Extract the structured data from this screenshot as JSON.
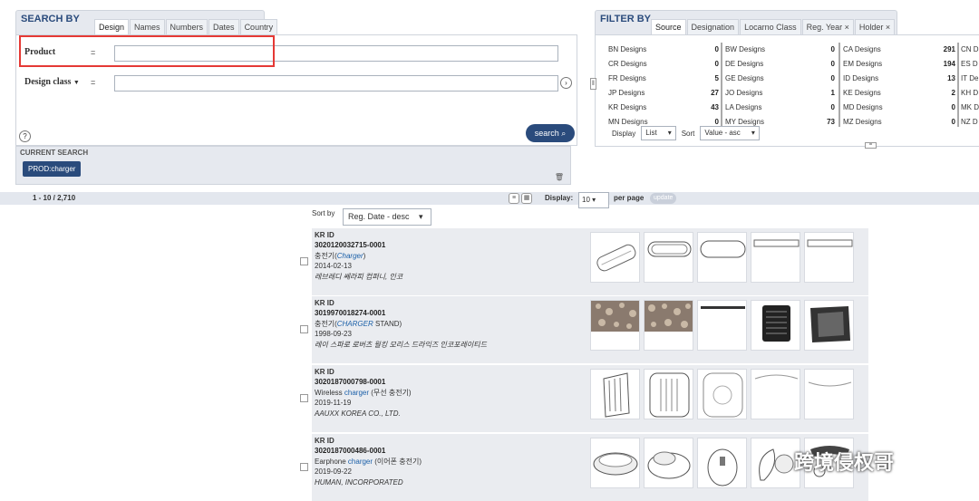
{
  "search": {
    "title": "SEARCH BY",
    "tabs": [
      "Design",
      "Names",
      "Numbers",
      "Dates",
      "Country"
    ],
    "product_label": "Product",
    "eq": "=",
    "design_class_label": "Design class",
    "design_class_arrow": "▼",
    "product_value": "",
    "design_class_value": "",
    "help": "?",
    "arrow": "›",
    "button": "search"
  },
  "current_search": {
    "title": "CURRENT SEARCH",
    "chip": "PROD:charger"
  },
  "filter": {
    "title": "FILTER BY",
    "tabs": [
      "Source",
      "Designation",
      "Locarno Class",
      "Reg. Year ×",
      "Holder ×"
    ],
    "columns": [
      [
        {
          "name": "BN Designs",
          "count": "0"
        },
        {
          "name": "CR Designs",
          "count": "0"
        },
        {
          "name": "FR Designs",
          "count": "5"
        },
        {
          "name": "JP Designs",
          "count": "27"
        },
        {
          "name": "KR Designs",
          "count": "43"
        },
        {
          "name": "MN Designs",
          "count": "0"
        }
      ],
      [
        {
          "name": "BW Designs",
          "count": "0"
        },
        {
          "name": "DE Designs",
          "count": "0"
        },
        {
          "name": "GE Designs",
          "count": "0"
        },
        {
          "name": "JO Designs",
          "count": "1"
        },
        {
          "name": "LA Designs",
          "count": "0"
        },
        {
          "name": "MY Designs",
          "count": "73"
        }
      ],
      [
        {
          "name": "CA Designs",
          "count": "291"
        },
        {
          "name": "EM Designs",
          "count": "194"
        },
        {
          "name": "ID Designs",
          "count": "13"
        },
        {
          "name": "KE Designs",
          "count": "2"
        },
        {
          "name": "MD Designs",
          "count": "0"
        },
        {
          "name": "MZ Designs",
          "count": "0"
        }
      ],
      [
        {
          "name": "CN D",
          "count": ""
        },
        {
          "name": "ES D",
          "count": ""
        },
        {
          "name": "IT De",
          "count": ""
        },
        {
          "name": "KH D",
          "count": ""
        },
        {
          "name": "MK D",
          "count": ""
        },
        {
          "name": "NZ D",
          "count": ""
        }
      ]
    ],
    "display_label": "Display",
    "display_value": "List",
    "sort_label": "Sort",
    "sort_value": "Value - asc"
  },
  "results": {
    "count": "1 - 10 / 2,710",
    "display_label": "Display:",
    "per_page_value": "10",
    "per_page_label": "per page",
    "update": "update",
    "sort_label": "Sort by",
    "sort_value": "Reg. Date - desc",
    "items": [
      {
        "source": "KR ID",
        "number": "3020120032715-0001",
        "title_pre": "충전기(",
        "title_hl": "Charger",
        "title_post": ")",
        "date": "2014-02-13",
        "owner": "레브레디 쎄라피 컴퍼니, 인코"
      },
      {
        "source": "KR ID",
        "number": "3019970018274-0001",
        "title_pre": "충전기(",
        "title_hl": "CHARGER",
        "title_post": " STAND)",
        "date": "1998-09-23",
        "owner": "레이 스파로 로버츠 월킹 모리스 드라익즈 인코포레이티드"
      },
      {
        "source": "KR ID",
        "number": "3020187000798-0001",
        "title_pre": "Wireless ",
        "title_hl": "charger",
        "title_post": " (무선 충전기)",
        "date": "2019-11-19",
        "owner": "AAUXX KOREA CO., LTD."
      },
      {
        "source": "KR ID",
        "number": "3020187000486-0001",
        "title_pre": "Earphone ",
        "title_hl": "charger",
        "title_post": " (이어폰 충전기)",
        "date": "2019-09-22",
        "owner": "HUMAN, INCORPORATED"
      }
    ]
  },
  "watermark": "跨境侵权哥"
}
